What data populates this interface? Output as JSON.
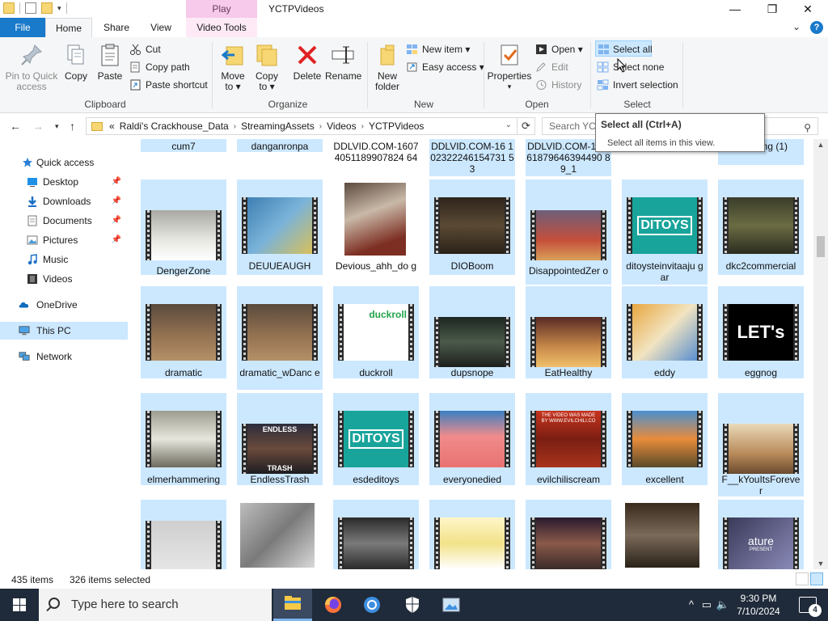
{
  "window": {
    "title": "YCTPVideos",
    "context_tab_top": "Play",
    "minimize": "—",
    "maximize": "❐",
    "close": "✕"
  },
  "tabs": {
    "file": "File",
    "home": "Home",
    "share": "Share",
    "view": "View",
    "video_tools": "Video Tools",
    "help": "?"
  },
  "ribbon": {
    "clipboard": {
      "label": "Clipboard",
      "pin_line1": "Pin to Quick",
      "pin_line2": "access",
      "copy": "Copy",
      "paste": "Paste",
      "cut": "Cut",
      "copy_path": "Copy path",
      "paste_shortcut": "Paste shortcut"
    },
    "organize": {
      "label": "Organize",
      "move_line1": "Move",
      "move_line2": "to ▾",
      "copyto_line1": "Copy",
      "copyto_line2": "to ▾",
      "delete": "Delete",
      "rename": "Rename"
    },
    "new": {
      "label": "New",
      "folder_line1": "New",
      "folder_line2": "folder",
      "new_item": "New item ▾",
      "easy_access": "Easy access ▾"
    },
    "open": {
      "label": "Open",
      "properties": "Properties",
      "open": "Open ▾",
      "edit": "Edit",
      "history": "History"
    },
    "select": {
      "label": "Select",
      "select_all": "Select all",
      "select_none": "Select none",
      "invert": "Invert selection"
    }
  },
  "tooltip": {
    "title": "Select all (Ctrl+A)",
    "desc": "Select all items in this view."
  },
  "address": {
    "crumbs": [
      "«",
      "Raldi's Crackhouse_Data",
      "StreamingAssets",
      "Videos",
      "YCTPVideos"
    ],
    "search_placeholder": "Search YCTPVideos"
  },
  "nav": [
    {
      "label": "Quick access",
      "icon": "star-icon"
    },
    {
      "label": "Desktop",
      "icon": "desktop-icon",
      "pinned": true
    },
    {
      "label": "Downloads",
      "icon": "downloads-icon",
      "pinned": true
    },
    {
      "label": "Documents",
      "icon": "documents-icon",
      "pinned": true
    },
    {
      "label": "Pictures",
      "icon": "pictures-icon",
      "pinned": true
    },
    {
      "label": "Music",
      "icon": "music-icon"
    },
    {
      "label": "Videos",
      "icon": "videos-icon"
    },
    {
      "label": "OneDrive",
      "icon": "onedrive-icon"
    },
    {
      "label": "This PC",
      "icon": "pc-icon"
    },
    {
      "label": "Network",
      "icon": "network-icon"
    }
  ],
  "top_labels": [
    "cum7",
    "danganronpa",
    "DDLVID.COM-16074051189907824 64",
    "DDLVID.COM-16 102322246154731 53",
    "DDLVID.COM-16 361879646394490 89_1",
    "",
    "TS_song (1)"
  ],
  "rows": [
    [
      "DengerZone",
      "DEUUEAUGH",
      "Devious_ahh_do g",
      "DIOBoom",
      "DisappointedZer o",
      "ditoysteinvitaaju gar",
      "dkc2commercial"
    ],
    [
      "dramatic",
      "dramatic_wDanc e",
      "duckroll",
      "dupsnope",
      "EatHealthy",
      "eddy",
      "eggnog"
    ],
    [
      "elmerhammering",
      "EndlessTrash",
      "esdeditoys",
      "everyonedied",
      "evilchiliscream",
      "excellent",
      "F__kYouItsForeve r"
    ],
    [
      "",
      "",
      "",
      "",
      "",
      "",
      ""
    ]
  ],
  "thumb_text": {
    "ditoys": "DITOYS",
    "duckroll": "duckroll",
    "lets": "LET's",
    "endless": "ENDLESS",
    "trash": "TRASH",
    "evil": "THE VIDEO WAS MADE BY WWW.EVILCHILI.CO",
    "nature": "ature",
    "present": "PRESENT"
  },
  "status": {
    "count": "435 items",
    "selected": "326 items selected"
  },
  "taskbar": {
    "search": "Type here to search",
    "time": "9:30 PM",
    "date": "7/10/2024",
    "notifications": "4"
  }
}
